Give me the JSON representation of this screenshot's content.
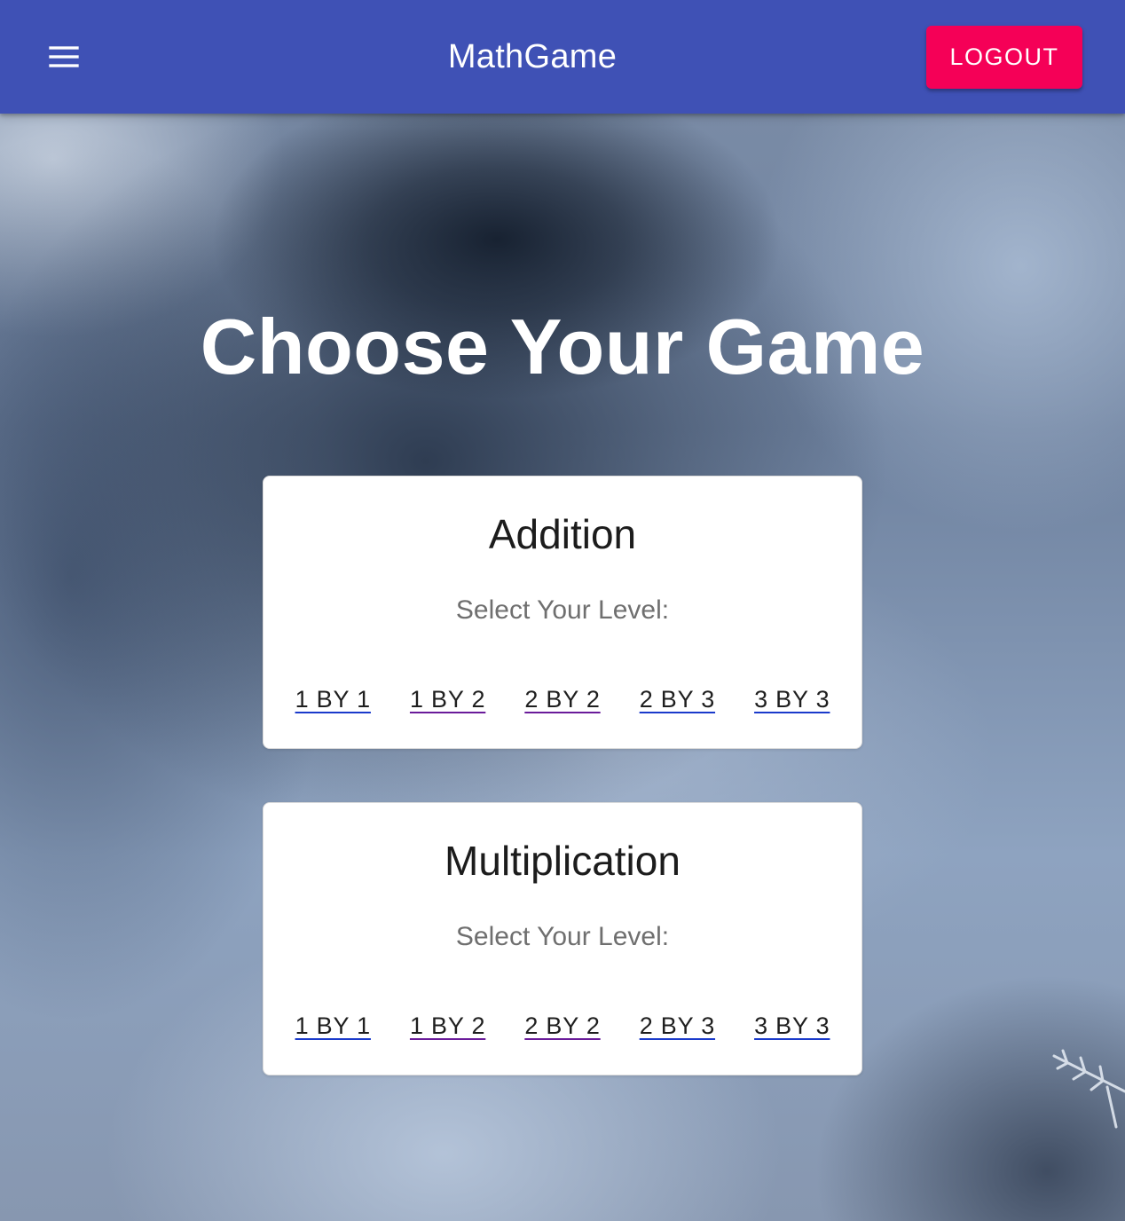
{
  "app_bar": {
    "title": "MathGame",
    "menu_icon": "hamburger-menu-icon",
    "logout_label": "LOGOUT",
    "colors": {
      "bar": "#3f51b5",
      "logout": "#f50057"
    }
  },
  "main": {
    "heading": "Choose Your Game",
    "games": [
      {
        "title": "Addition",
        "subtitle": "Select Your Level:",
        "levels": [
          "1 BY 1",
          "1 BY 2",
          "2 BY 2",
          "2 BY 3",
          "3 BY 3"
        ]
      },
      {
        "title": "Multiplication",
        "subtitle": "Select Your Level:",
        "levels": [
          "1 BY 1",
          "1 BY 2",
          "2 BY 2",
          "2 BY 3",
          "3 BY 3"
        ]
      }
    ]
  }
}
